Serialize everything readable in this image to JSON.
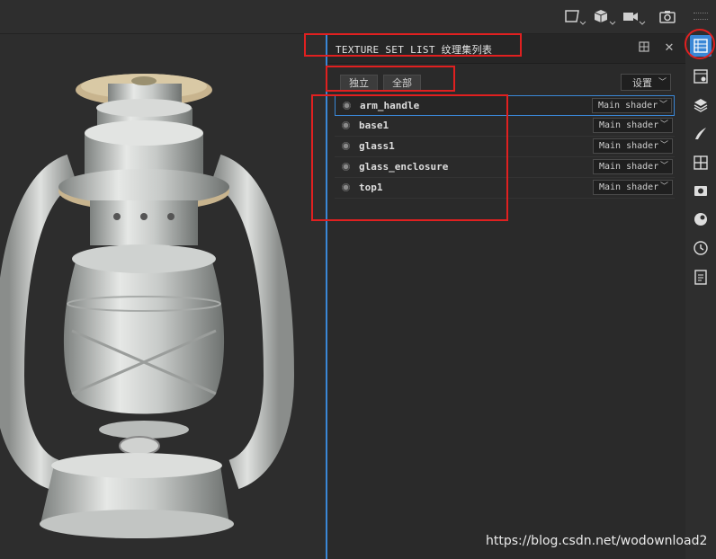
{
  "toolbar": {
    "icons": [
      "camera-view-icon",
      "cube-icon",
      "video-camera-icon",
      "screenshot-camera-icon"
    ]
  },
  "panel": {
    "title": "TEXTURE SET LIST 纹理集列表",
    "buttons": {
      "solo": "独立",
      "all": "全部",
      "settings": "设置"
    },
    "texture_sets": [
      {
        "name": "arm_handle",
        "shader": "Main shader",
        "selected": true
      },
      {
        "name": "base1",
        "shader": "Main shader",
        "selected": false
      },
      {
        "name": "glass1",
        "shader": "Main shader",
        "selected": false
      },
      {
        "name": "glass_enclosure",
        "shader": "Main shader",
        "selected": false
      },
      {
        "name": "top1",
        "shader": "Main shader",
        "selected": false
      }
    ]
  },
  "sidebar": {
    "icons": [
      "texture-set-list-icon",
      "texture-set-settings-icon",
      "layers-icon",
      "brush-properties-icon",
      "display-settings-icon",
      "viewer-settings-icon",
      "shader-settings-icon",
      "history-icon",
      "log-icon"
    ]
  },
  "watermark": "https://blog.csdn.net/wodownload2",
  "colors": {
    "accent": "#3a87d6",
    "annotation": "#e02020",
    "background": "#2b2b2b"
  }
}
